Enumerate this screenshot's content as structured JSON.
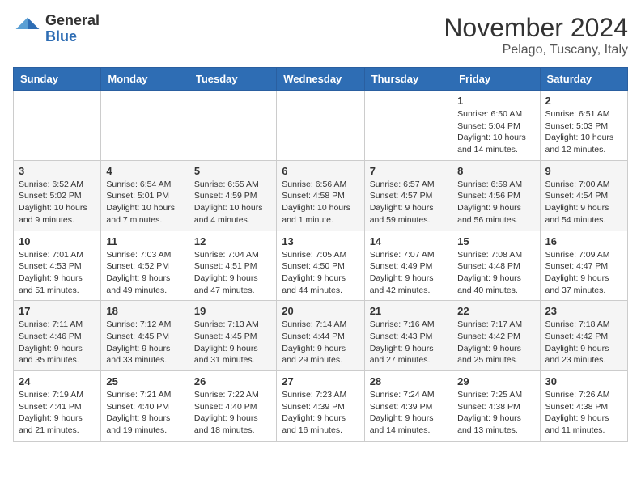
{
  "header": {
    "logo_general": "General",
    "logo_blue": "Blue",
    "month": "November 2024",
    "location": "Pelago, Tuscany, Italy"
  },
  "weekdays": [
    "Sunday",
    "Monday",
    "Tuesday",
    "Wednesday",
    "Thursday",
    "Friday",
    "Saturday"
  ],
  "weeks": [
    [
      {
        "day": "",
        "info": ""
      },
      {
        "day": "",
        "info": ""
      },
      {
        "day": "",
        "info": ""
      },
      {
        "day": "",
        "info": ""
      },
      {
        "day": "",
        "info": ""
      },
      {
        "day": "1",
        "info": "Sunrise: 6:50 AM\nSunset: 5:04 PM\nDaylight: 10 hours and 14 minutes."
      },
      {
        "day": "2",
        "info": "Sunrise: 6:51 AM\nSunset: 5:03 PM\nDaylight: 10 hours and 12 minutes."
      }
    ],
    [
      {
        "day": "3",
        "info": "Sunrise: 6:52 AM\nSunset: 5:02 PM\nDaylight: 10 hours and 9 minutes."
      },
      {
        "day": "4",
        "info": "Sunrise: 6:54 AM\nSunset: 5:01 PM\nDaylight: 10 hours and 7 minutes."
      },
      {
        "day": "5",
        "info": "Sunrise: 6:55 AM\nSunset: 4:59 PM\nDaylight: 10 hours and 4 minutes."
      },
      {
        "day": "6",
        "info": "Sunrise: 6:56 AM\nSunset: 4:58 PM\nDaylight: 10 hours and 1 minute."
      },
      {
        "day": "7",
        "info": "Sunrise: 6:57 AM\nSunset: 4:57 PM\nDaylight: 9 hours and 59 minutes."
      },
      {
        "day": "8",
        "info": "Sunrise: 6:59 AM\nSunset: 4:56 PM\nDaylight: 9 hours and 56 minutes."
      },
      {
        "day": "9",
        "info": "Sunrise: 7:00 AM\nSunset: 4:54 PM\nDaylight: 9 hours and 54 minutes."
      }
    ],
    [
      {
        "day": "10",
        "info": "Sunrise: 7:01 AM\nSunset: 4:53 PM\nDaylight: 9 hours and 51 minutes."
      },
      {
        "day": "11",
        "info": "Sunrise: 7:03 AM\nSunset: 4:52 PM\nDaylight: 9 hours and 49 minutes."
      },
      {
        "day": "12",
        "info": "Sunrise: 7:04 AM\nSunset: 4:51 PM\nDaylight: 9 hours and 47 minutes."
      },
      {
        "day": "13",
        "info": "Sunrise: 7:05 AM\nSunset: 4:50 PM\nDaylight: 9 hours and 44 minutes."
      },
      {
        "day": "14",
        "info": "Sunrise: 7:07 AM\nSunset: 4:49 PM\nDaylight: 9 hours and 42 minutes."
      },
      {
        "day": "15",
        "info": "Sunrise: 7:08 AM\nSunset: 4:48 PM\nDaylight: 9 hours and 40 minutes."
      },
      {
        "day": "16",
        "info": "Sunrise: 7:09 AM\nSunset: 4:47 PM\nDaylight: 9 hours and 37 minutes."
      }
    ],
    [
      {
        "day": "17",
        "info": "Sunrise: 7:11 AM\nSunset: 4:46 PM\nDaylight: 9 hours and 35 minutes."
      },
      {
        "day": "18",
        "info": "Sunrise: 7:12 AM\nSunset: 4:45 PM\nDaylight: 9 hours and 33 minutes."
      },
      {
        "day": "19",
        "info": "Sunrise: 7:13 AM\nSunset: 4:45 PM\nDaylight: 9 hours and 31 minutes."
      },
      {
        "day": "20",
        "info": "Sunrise: 7:14 AM\nSunset: 4:44 PM\nDaylight: 9 hours and 29 minutes."
      },
      {
        "day": "21",
        "info": "Sunrise: 7:16 AM\nSunset: 4:43 PM\nDaylight: 9 hours and 27 minutes."
      },
      {
        "day": "22",
        "info": "Sunrise: 7:17 AM\nSunset: 4:42 PM\nDaylight: 9 hours and 25 minutes."
      },
      {
        "day": "23",
        "info": "Sunrise: 7:18 AM\nSunset: 4:42 PM\nDaylight: 9 hours and 23 minutes."
      }
    ],
    [
      {
        "day": "24",
        "info": "Sunrise: 7:19 AM\nSunset: 4:41 PM\nDaylight: 9 hours and 21 minutes."
      },
      {
        "day": "25",
        "info": "Sunrise: 7:21 AM\nSunset: 4:40 PM\nDaylight: 9 hours and 19 minutes."
      },
      {
        "day": "26",
        "info": "Sunrise: 7:22 AM\nSunset: 4:40 PM\nDaylight: 9 hours and 18 minutes."
      },
      {
        "day": "27",
        "info": "Sunrise: 7:23 AM\nSunset: 4:39 PM\nDaylight: 9 hours and 16 minutes."
      },
      {
        "day": "28",
        "info": "Sunrise: 7:24 AM\nSunset: 4:39 PM\nDaylight: 9 hours and 14 minutes."
      },
      {
        "day": "29",
        "info": "Sunrise: 7:25 AM\nSunset: 4:38 PM\nDaylight: 9 hours and 13 minutes."
      },
      {
        "day": "30",
        "info": "Sunrise: 7:26 AM\nSunset: 4:38 PM\nDaylight: 9 hours and 11 minutes."
      }
    ]
  ]
}
